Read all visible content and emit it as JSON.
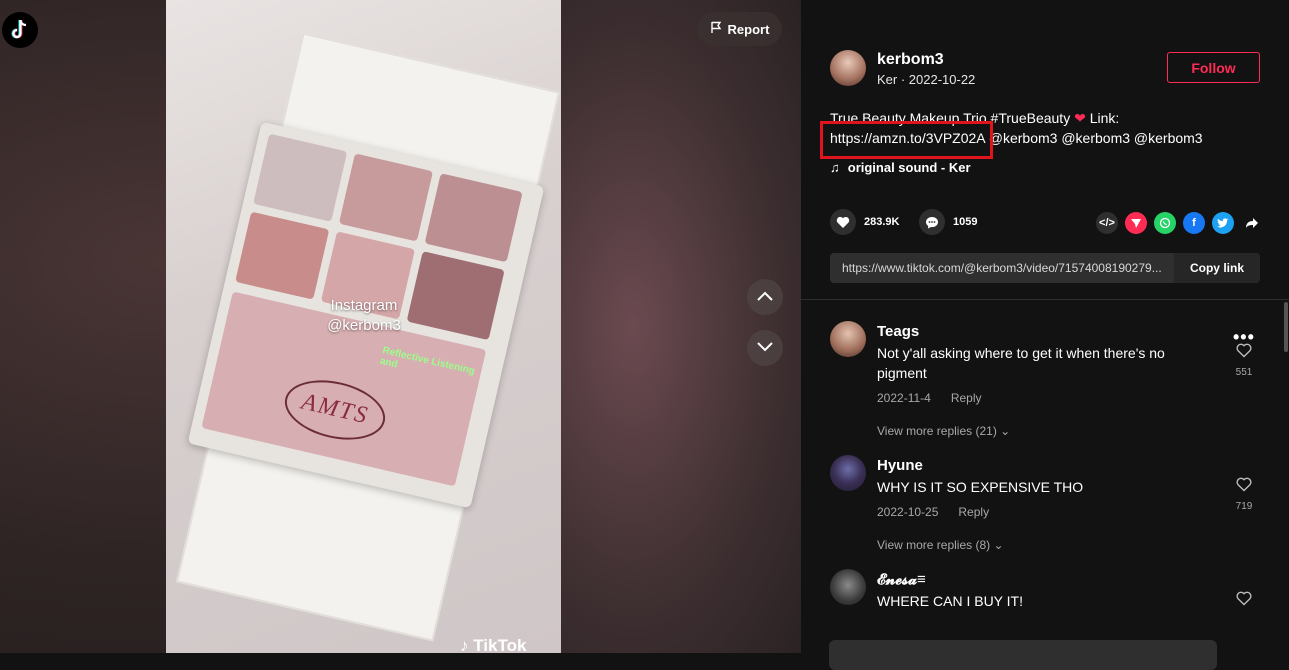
{
  "player": {
    "report_label": "Report",
    "overlay_text": [
      "Instagram",
      "@kerbom3"
    ],
    "holo_text": "Reflective Listening and",
    "palette_logo": "AMTS",
    "watermark": "TikTok"
  },
  "author": {
    "username": "kerbom3",
    "meta": "Ker · 2022-10-22",
    "follow_label": "Follow"
  },
  "description": {
    "line1_text": "True Beauty Makeup Trio #TrueBeauty",
    "link_label": "Link:",
    "link_url": "https://amzn.to/3VPZ02A",
    "mentions": "@kerbom3 @kerbom3 @kerbom3",
    "sound": "original sound - Ker"
  },
  "stats": {
    "likes": "283.9K",
    "comments": "1059"
  },
  "share_url": {
    "url": "https://www.tiktok.com/@kerbom3/video/71574008190279...",
    "copy_label": "Copy link"
  },
  "comments": [
    {
      "user": "Teags",
      "text": "Not y'all asking where to get it when there's no pigment",
      "date": "2022-11-4",
      "reply_label": "Reply",
      "likes": "551",
      "more_replies": "View more replies (21)"
    },
    {
      "user": "Hyune",
      "text": "WHY IS IT SO EXPENSIVE THO",
      "date": "2022-10-25",
      "reply_label": "Reply",
      "likes": "719",
      "more_replies": "View more replies (8)"
    },
    {
      "user": "𝓔𝓷𝓮𝓼𝓪≡",
      "text": "WHERE CAN I BUY IT!",
      "likes": ""
    }
  ],
  "colors": {
    "accent": "#fe2c55",
    "highlight_box": "#e0141c",
    "panel_bg": "#121212"
  },
  "icons": {
    "report": "flag-icon",
    "up": "chevron-up-icon",
    "down": "chevron-down-icon",
    "like": "heart-icon",
    "comment": "comment-icon",
    "embed": "embed-icon",
    "send": "send-icon",
    "whatsapp": "whatsapp-icon",
    "facebook": "facebook-icon",
    "twitter": "twitter-icon",
    "share": "share-arrow-icon",
    "music": "music-note-icon"
  }
}
